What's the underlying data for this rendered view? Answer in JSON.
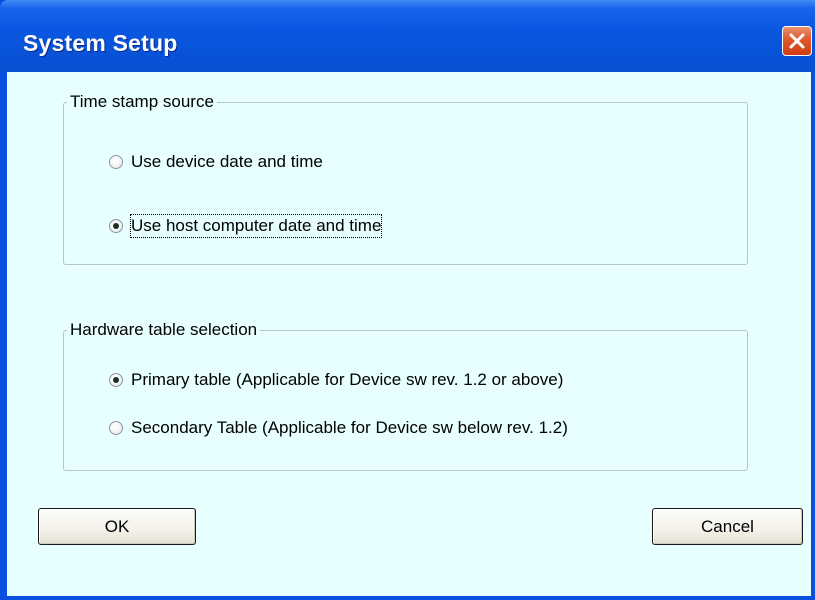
{
  "window": {
    "title": "System Setup",
    "close_icon": "close-icon"
  },
  "timestamp_group": {
    "label": "Time stamp source",
    "options": [
      {
        "label": "Use device date and time",
        "selected": false
      },
      {
        "label": "Use host computer date and time",
        "selected": true
      }
    ]
  },
  "hardware_group": {
    "label": "Hardware table selection",
    "options": [
      {
        "label": "Primary table  (Applicable for Device sw rev. 1.2 or above)",
        "selected": true
      },
      {
        "label": "Secondary Table (Applicable for Device sw  below  rev. 1.2)",
        "selected": false
      }
    ]
  },
  "buttons": {
    "ok_label": "OK",
    "cancel_label": "Cancel"
  },
  "colors": {
    "titlebar": "#0a57e1",
    "client_background": "#e8ffff",
    "close_button": "#e0582a"
  }
}
